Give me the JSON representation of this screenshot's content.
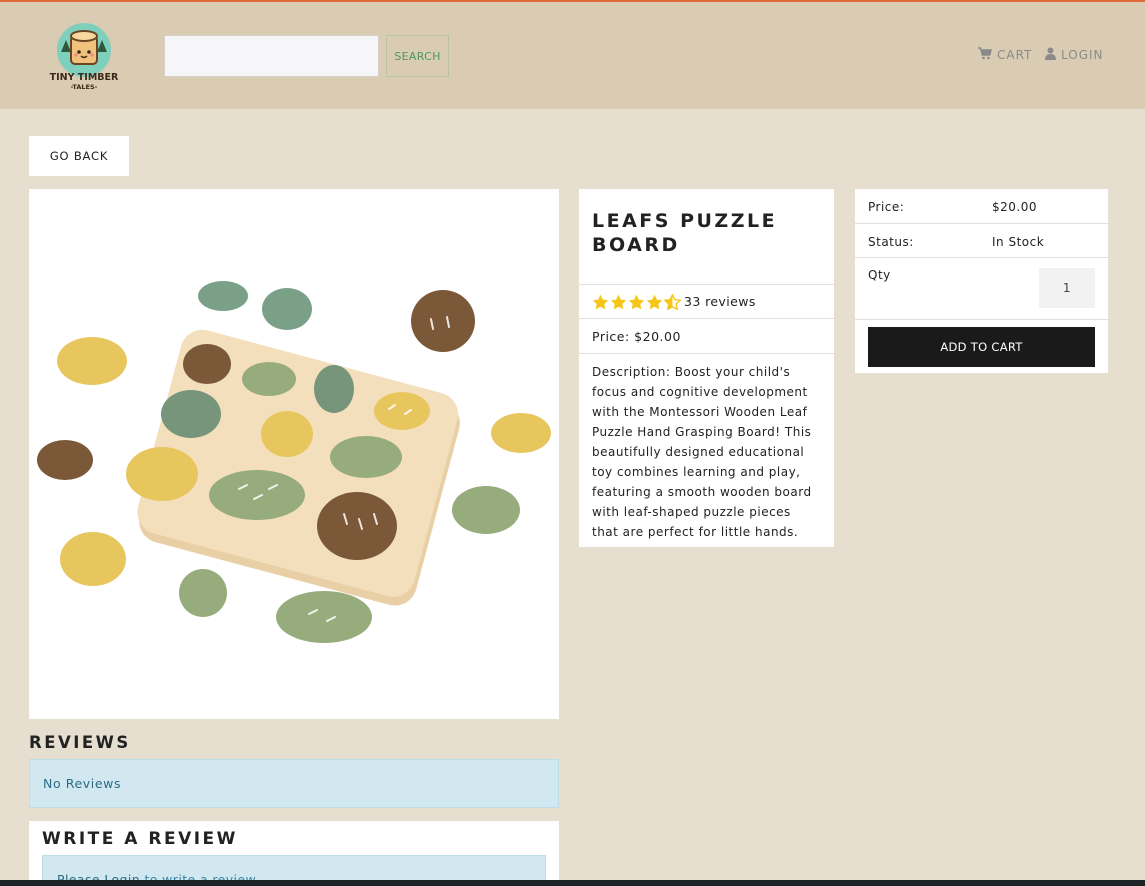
{
  "brand": {
    "line1": "TINY TIMBER",
    "line2": "-TALES-"
  },
  "search": {
    "placeholder": "",
    "button_label": "SEARCH"
  },
  "nav": {
    "cart_label": "CART",
    "login_label": "LOGIN"
  },
  "go_back_label": "GO BACK",
  "product": {
    "name": "LEAFS PUZZLE BOARD",
    "rating": 4.5,
    "reviews_text": "33 reviews",
    "price_text": "Price: $20.00",
    "description": "Description: Boost your child's focus and cognitive development with the Montessori Wooden Leaf Puzzle Hand Grasping Board! This beautifully designed educational toy combines learning and play, featuring a smooth wooden board with leaf-shaped puzzle pieces that are perfect for little hands."
  },
  "purchase": {
    "price_label": "Price:",
    "price_value": "$20.00",
    "status_label": "Status:",
    "status_value": "In Stock",
    "qty_label": "Qty",
    "qty_value": "1",
    "add_to_cart_label": "ADD TO CART"
  },
  "reviews": {
    "heading": "REVIEWS",
    "empty_text": "No Reviews",
    "write_heading": "WRITE A REVIEW",
    "login_prefix": "Please ",
    "login_link": "Login",
    "login_suffix": " to write a review"
  },
  "colors": {
    "accent_star": "#f5c518",
    "top_line": "#e06a3c",
    "alert_bg": "#d1e8f1",
    "button_dark": "#1a1a1a"
  },
  "icons": {
    "cart": "cart-icon",
    "login": "user-icon",
    "star": "star-icon"
  }
}
